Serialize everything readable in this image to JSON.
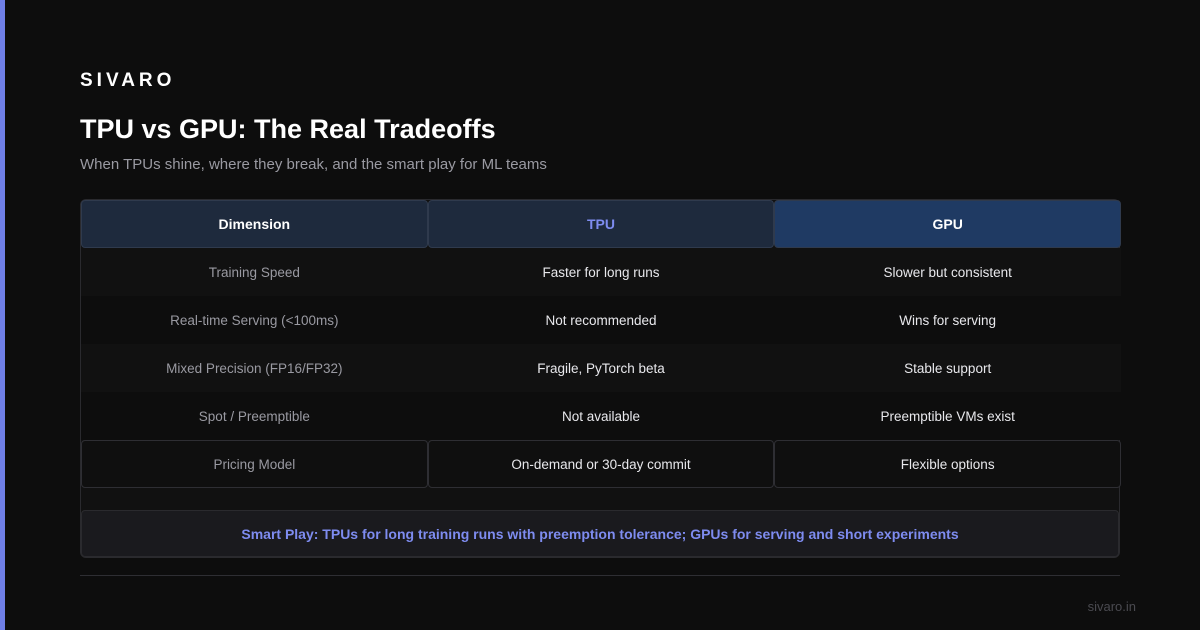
{
  "brand": "SIVARO",
  "title": "TPU vs GPU: The Real Tradeoffs",
  "subtitle": "When TPUs shine, where they break, and the smart play for ML teams",
  "table": {
    "headers": [
      "Dimension",
      "TPU",
      "GPU"
    ],
    "rows": [
      [
        "Training Speed",
        "Faster for long runs",
        "Slower but consistent"
      ],
      [
        "Real-time Serving (<100ms)",
        "Not recommended",
        "Wins for serving"
      ],
      [
        "Mixed Precision (FP16/FP32)",
        "Fragile, PyTorch beta",
        "Stable support"
      ],
      [
        "Spot / Preemptible",
        "Not available",
        "Preemptible VMs exist"
      ],
      [
        "Pricing Model",
        "On-demand or 30-day commit",
        "Flexible options"
      ]
    ]
  },
  "smart_play": "Smart Play: TPUs for long training runs with preemption tolerance; GPUs for serving and short experiments",
  "footer": {
    "url": "sivaro.in"
  },
  "colors": {
    "accent": "#6f7fe6",
    "tpu_header": "#7e8cf0",
    "gpu_header_bg": "#1f3a63"
  }
}
